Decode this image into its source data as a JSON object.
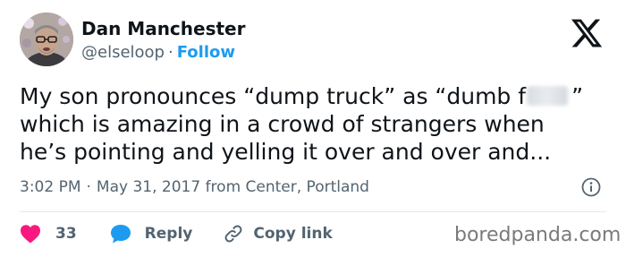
{
  "author": {
    "name": "Dan Manchester",
    "handle": "@elseloop",
    "separator": "·",
    "follow_label": "Follow"
  },
  "tweet": {
    "line1_before": "My son pronounces “dump truck” as “dumb f",
    "line1_after": "”",
    "line2": "which is amazing in a crowd of strangers when",
    "line3": "he’s pointing and yelling it over and over and..."
  },
  "meta": {
    "time": "3:02 PM",
    "separator": "·",
    "date_location": "May 31, 2017 from Center, Portland"
  },
  "actions": {
    "like_count": "33",
    "reply_label": "Reply",
    "copy_link_label": "Copy link"
  },
  "watermark": {
    "text": "boredpanda.com"
  },
  "colors": {
    "text": "#0f1419",
    "secondary": "#536471",
    "accent": "#1d9bf0",
    "like": "#f91880",
    "divider": "#e6e9ec"
  },
  "icons": [
    "x-logo-icon",
    "info-icon",
    "heart-icon",
    "reply-bubble-icon",
    "link-icon"
  ]
}
